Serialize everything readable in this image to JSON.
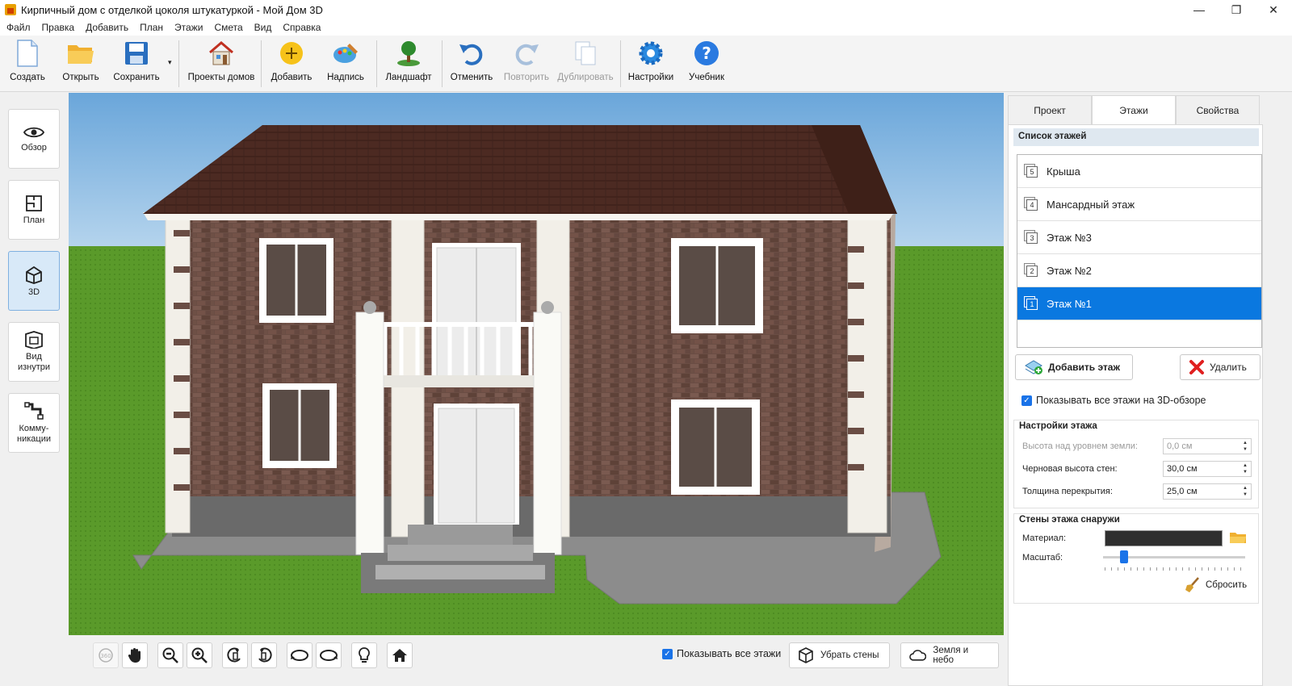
{
  "window": {
    "title": "Кирпичный дом с отделкой цоколя штукатуркой - Мой Дом 3D",
    "minimize": "—",
    "maximize": "❐",
    "close": "✕"
  },
  "menu": [
    "Файл",
    "Правка",
    "Добавить",
    "План",
    "Этажи",
    "Смета",
    "Вид",
    "Справка"
  ],
  "toolbar": {
    "create": "Создать",
    "open": "Открыть",
    "save": "Сохранить",
    "save_dropdown": "▾",
    "house_projects": "Проекты домов",
    "add": "Добавить",
    "caption": "Надпись",
    "landscape": "Ландшафт",
    "undo": "Отменить",
    "redo": "Повторить",
    "duplicate": "Дублировать",
    "settings": "Настройки",
    "tutorial": "Учебник"
  },
  "left_panel": {
    "overview": "Обзор",
    "plan": "План",
    "view_3d": "3D",
    "inside_view_line1": "Вид",
    "inside_view_line2": "изнутри",
    "utilities_line1": "Комму-",
    "utilities_line2": "никации"
  },
  "bottom_bar": {
    "show_all_floors": "Показывать все этажи",
    "remove_walls": "Убрать стены",
    "ground_and_sky": "Земля и небо"
  },
  "right_panel": {
    "tabs": [
      "Проект",
      "Этажи",
      "Свойства"
    ],
    "active_tab": "Этажи",
    "floor_list_header": "Список этажей",
    "floors": [
      {
        "num": "5",
        "name": "Крыша"
      },
      {
        "num": "4",
        "name": "Мансардный этаж"
      },
      {
        "num": "3",
        "name": "Этаж №3"
      },
      {
        "num": "2",
        "name": "Этаж №2"
      },
      {
        "num": "1",
        "name": "Этаж №1"
      }
    ],
    "selected_floor": "Этаж №1",
    "add_floor": "Добавить этаж",
    "delete": "Удалить",
    "show_all_3d": "Показывать все этажи на 3D-обзоре",
    "floor_settings": {
      "header": "Настройки этажа",
      "height_label": "Высота над уровнем земли:",
      "height_value": "0,0 см",
      "wall_height_label": "Черновая высота стен:",
      "wall_height_value": "30,0 см",
      "slab_label": "Толщина перекрытия:",
      "slab_value": "25,0 см"
    },
    "outer_walls": {
      "header": "Стены этажа снаружи",
      "material_label": "Материал:",
      "scale_label": "Масштаб:",
      "scale_level": 0.15,
      "reset": "Сбросить"
    }
  },
  "colors": {
    "accent": "#0a78e0",
    "brick": "#6b4a40",
    "roof": "#4a2a22",
    "grass": "#5a9a2a",
    "sky": "#7ab2de"
  }
}
